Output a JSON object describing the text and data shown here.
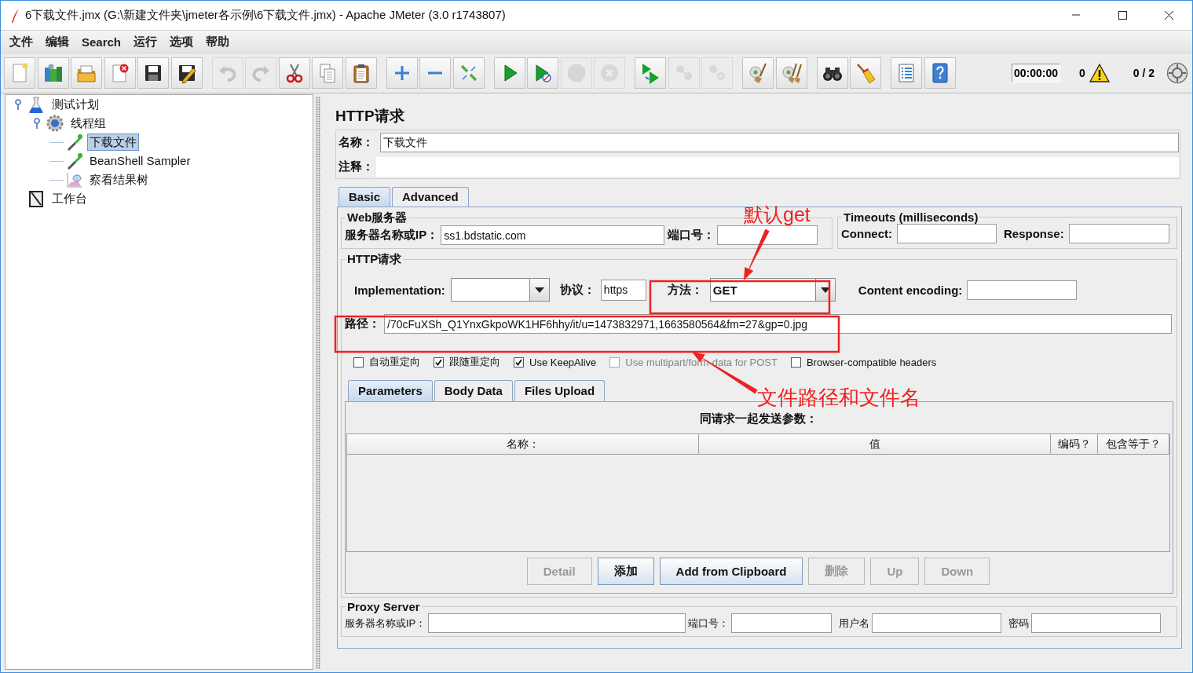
{
  "window": {
    "title": "6下载文件.jmx (G:\\新建文件夹\\jmeter各示例\\6下载文件.jmx) - Apache JMeter (3.0 r1743807)"
  },
  "menu": [
    {
      "label": "文件"
    },
    {
      "label": "编辑"
    },
    {
      "label": "Search"
    },
    {
      "label": "运行"
    },
    {
      "label": "选项"
    },
    {
      "label": "帮助"
    }
  ],
  "toolbar": {
    "groups": [
      [
        {
          "kind": "new",
          "disabled": false
        },
        {
          "kind": "templates",
          "disabled": false
        },
        {
          "kind": "open",
          "disabled": false
        },
        {
          "kind": "close",
          "disabled": false
        },
        {
          "kind": "save",
          "disabled": false
        },
        {
          "kind": "save_as",
          "disabled": false
        }
      ],
      [
        {
          "kind": "undo",
          "disabled": true
        },
        {
          "kind": "redo",
          "disabled": true
        },
        {
          "kind": "cut",
          "disabled": false
        },
        {
          "kind": "copy",
          "disabled": false
        },
        {
          "kind": "paste",
          "disabled": false
        }
      ],
      [
        {
          "kind": "expand",
          "disabled": false
        },
        {
          "kind": "collapse",
          "disabled": false
        },
        {
          "kind": "toggle",
          "disabled": false
        }
      ],
      [
        {
          "kind": "start",
          "disabled": false
        },
        {
          "kind": "start_no_timers",
          "disabled": false
        },
        {
          "kind": "stop",
          "disabled": true
        },
        {
          "kind": "shutdown",
          "disabled": true
        }
      ],
      [
        {
          "kind": "remote_start",
          "disabled": false
        },
        {
          "kind": "remote_stop",
          "disabled": true
        },
        {
          "kind": "remote_shutdown",
          "disabled": true
        }
      ],
      [
        {
          "kind": "clear",
          "disabled": false
        },
        {
          "kind": "clear_all",
          "disabled": false
        }
      ],
      [
        {
          "kind": "search",
          "disabled": false
        },
        {
          "kind": "reset_search",
          "disabled": false
        }
      ],
      [
        {
          "kind": "function_helper",
          "disabled": false
        },
        {
          "kind": "help",
          "disabled": false
        }
      ]
    ],
    "timer": "00:00:00",
    "error_count": "0",
    "threads": "0 / 2"
  },
  "tree": [
    {
      "label": "测试计划",
      "kind": "test_plan",
      "selected": false,
      "expanded": true,
      "children": [
        {
          "label": "线程组",
          "kind": "thread_group",
          "selected": false,
          "expanded": true,
          "children": [
            {
              "label": "下载文件",
              "kind": "sampler",
              "selected": true
            },
            {
              "label": "BeanShell Sampler",
              "kind": "sampler",
              "selected": false
            },
            {
              "label": "察看结果树",
              "kind": "listener",
              "selected": false
            }
          ]
        }
      ]
    },
    {
      "label": "工作台",
      "kind": "workbench",
      "selected": false
    }
  ],
  "editor": {
    "title": "HTTP请求",
    "name": {
      "label": "名称：",
      "value": "下载文件"
    },
    "comments": {
      "label": "注释："
    },
    "tabs": [
      {
        "label": "Basic",
        "selected": true
      },
      {
        "label": "Advanced",
        "selected": false
      }
    ],
    "web_server": {
      "title": "Web服务器",
      "server_label": "服务器名称或IP：",
      "server_value": "ss1.bdstatic.com",
      "port_label": "端口号："
    },
    "timeouts": {
      "title": "Timeouts (milliseconds)",
      "connect_label": "Connect:",
      "response_label": "Response:"
    },
    "http_request": {
      "title": "HTTP请求",
      "implementation_label": "Implementation:",
      "protocol_label": "协议：",
      "protocol_value": "https",
      "method_label": "方法：",
      "method_value": "GET",
      "encoding_label": "Content encoding:",
      "path_label": "路径：",
      "path_value": "/70cFuXSh_Q1YnxGkpoWK1HF6hhy/it/u=1473832971,1663580564&fm=27&gp=0.jpg",
      "options": [
        {
          "label": "自动重定向",
          "checked": false,
          "disabled": false
        },
        {
          "label": "跟随重定向",
          "checked": true,
          "disabled": false
        },
        {
          "label": "Use KeepAlive",
          "checked": true,
          "disabled": false
        },
        {
          "label": "Use multipart/form-data for POST",
          "checked": false,
          "disabled": true
        },
        {
          "label": "Browser-compatible headers",
          "checked": false,
          "disabled": false
        }
      ],
      "tabs": [
        {
          "label": "Parameters",
          "selected": true
        },
        {
          "label": "Body Data",
          "selected": false
        },
        {
          "label": "Files Upload",
          "selected": false
        }
      ],
      "parameters": {
        "caption": "同请求一起发送参数：",
        "columns": [
          "名称：",
          "值",
          "编码？",
          "包含等于？"
        ]
      },
      "buttons": [
        {
          "label": "Detail",
          "disabled": true
        },
        {
          "label": "添加",
          "disabled": false
        },
        {
          "label": "Add from Clipboard",
          "disabled": false
        },
        {
          "label": "删除",
          "disabled": true
        },
        {
          "label": "Up",
          "disabled": true
        },
        {
          "label": "Down",
          "disabled": true
        }
      ]
    },
    "proxy": {
      "title": "Proxy Server",
      "fields": [
        {
          "label": "服务器名称或IP："
        },
        {
          "label": "端口号："
        },
        {
          "label": "用户名"
        },
        {
          "label": "密码"
        }
      ]
    }
  },
  "annotations": [
    {
      "text": "默认get"
    },
    {
      "text": "文件路径和文件名"
    }
  ]
}
